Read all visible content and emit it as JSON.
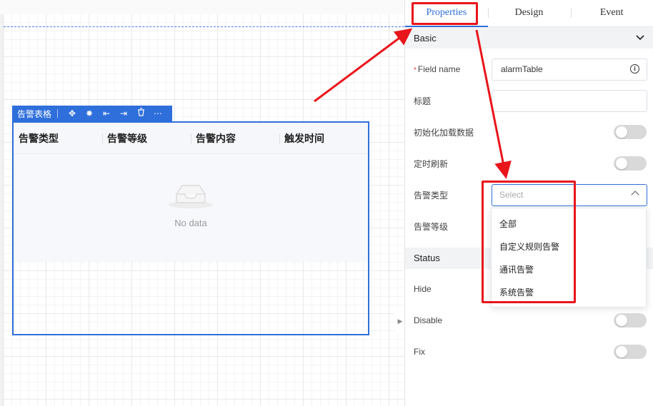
{
  "widget": {
    "name": "告警表格",
    "toolbar_icons": [
      "move-icon",
      "bug-icon",
      "align-left-icon",
      "align-right-icon",
      "delete-icon",
      "more-icon"
    ],
    "toolbar_glyphs": [
      "✥",
      "✸",
      "⇤",
      "⇥",
      "🗑",
      "⋯"
    ]
  },
  "table": {
    "columns": [
      "告警类型",
      "告警等级",
      "告警内容",
      "触发时间"
    ],
    "empty_text": "No data"
  },
  "panel": {
    "tabs": [
      "Properties",
      "Design",
      "Event"
    ],
    "basic_section": "Basic",
    "fields": {
      "field_name_label": "Field name",
      "field_name_value": "alarmTable",
      "title_label": "标题",
      "init_load_label": "初始化加载数据",
      "timed_refresh_label": "定时刷新",
      "alarm_type_label": "告警类型",
      "alarm_type_placeholder": "Select",
      "alarm_level_label": "告警等级"
    },
    "status_section": "Status",
    "status_fields": [
      "Hide",
      "Disable",
      "Fix"
    ],
    "dropdown_options": [
      "全部",
      "自定义规则告警",
      "通讯告警",
      "系统告警"
    ]
  },
  "colors": {
    "accent": "#2f6fdb",
    "annotation": "#e8151b"
  }
}
